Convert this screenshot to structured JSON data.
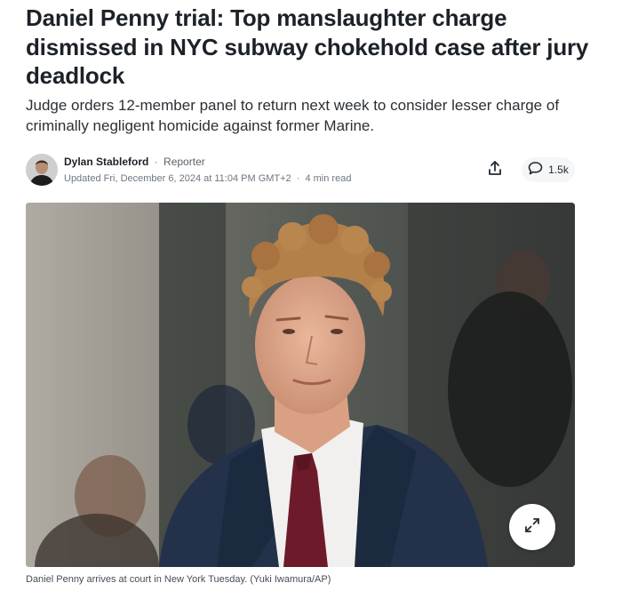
{
  "article": {
    "headline": "Daniel Penny trial: Top manslaughter charge dismissed in NYC subway chokehold case after jury deadlock",
    "subheadline": "Judge orders 12-member panel to return next week to consider lesser charge of criminally negligent homicide against former Marine."
  },
  "byline": {
    "author_name": "Dylan Stableford",
    "separator": "·",
    "author_role": "Reporter",
    "updated": "Updated Fri, December 6, 2024 at 11:04 PM GMT+2",
    "meta_separator": "·",
    "read_time": "4 min read",
    "avatar_icon": "author-avatar"
  },
  "actions": {
    "share_icon": "share-icon",
    "comments_icon": "comment-bubble-icon",
    "comments_count": "1.5k"
  },
  "media": {
    "expand_icon": "expand-icon",
    "caption": "Daniel Penny arrives at court in New York Tuesday. (Yuki Iwamura/AP)"
  },
  "colors": {
    "headline": "#1d2228",
    "body_text": "#2b3035",
    "meta_text": "#6e7780",
    "button_bg": "#f5f6f7"
  }
}
